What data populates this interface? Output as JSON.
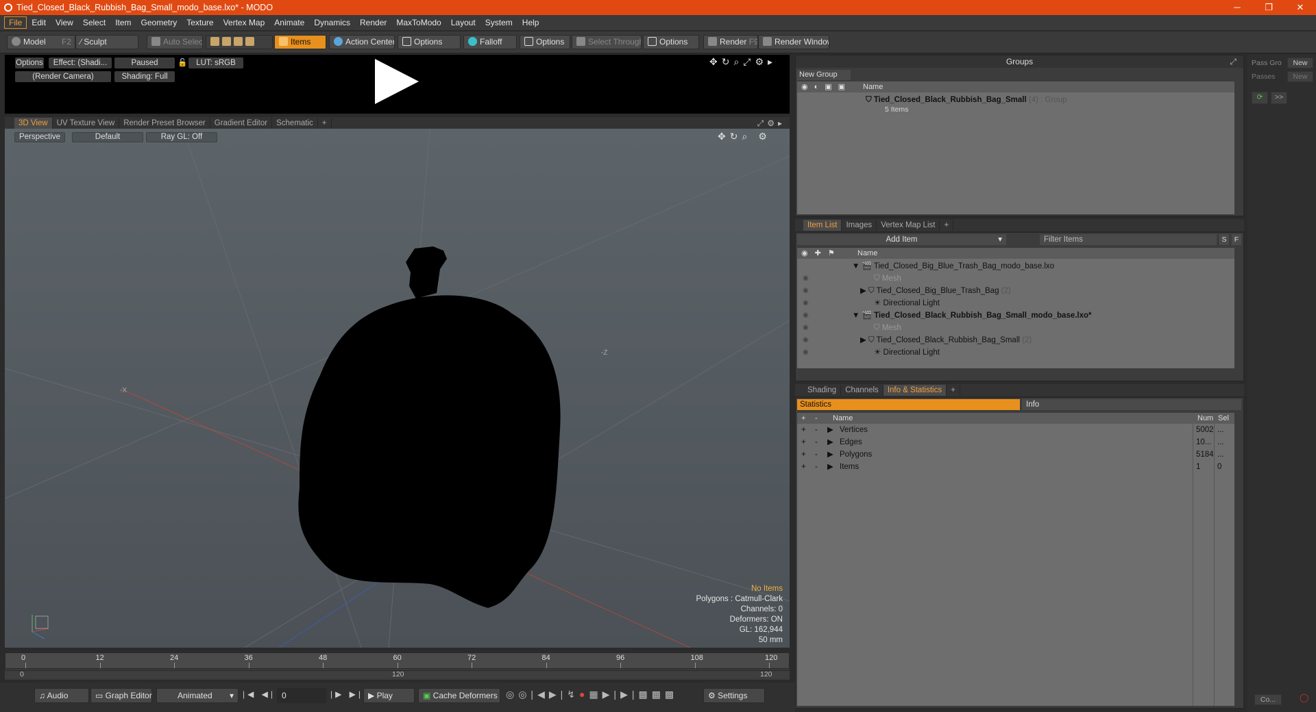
{
  "window": {
    "title": "Tied_Closed_Black_Rubbish_Bag_Small_modo_base.lxo* - MODO",
    "min": "─",
    "max": "❐",
    "close": "✕"
  },
  "menu": [
    "File",
    "Edit",
    "View",
    "Select",
    "Item",
    "Geometry",
    "Texture",
    "Vertex Map",
    "Animate",
    "Dynamics",
    "Render",
    "MaxToModo",
    "Layout",
    "System",
    "Help"
  ],
  "toolbar": {
    "model": "Model",
    "model_key": "F2",
    "sculpt": "Sculpt",
    "auto_select": "Auto Select",
    "items": "Items",
    "action_center": "Action Center",
    "options1": "Options",
    "falloff": "Falloff",
    "options2": "Options",
    "select_through": "Select Through",
    "options3": "Options",
    "render": "Render",
    "render_key": "F9",
    "render_window": "Render Window"
  },
  "preview": {
    "options": "Options",
    "effect": "Effect: (Shadi...",
    "paused": "Paused",
    "lut": "LUT: sRGB",
    "camera": "(Render Camera)",
    "shading": "Shading: Full"
  },
  "viewtabs": [
    "3D View",
    "UV Texture View",
    "Render Preset Browser",
    "Gradient Editor",
    "Schematic",
    "+"
  ],
  "viewport": {
    "perspective": "Perspective",
    "default": "Default",
    "raygl": "Ray GL: Off",
    "info": {
      "no_items": "No Items",
      "polygons": "Polygons : Catmull-Clark",
      "channels": "Channels: 0",
      "deformers": "Deformers: ON",
      "gl": "GL: 162,944",
      "mm": "50 mm"
    },
    "axis_x": "-X",
    "axis_z": "-Z"
  },
  "timeline": {
    "ticks": [
      "0",
      "12",
      "24",
      "36",
      "48",
      "60",
      "72",
      "84",
      "96",
      "108",
      "120"
    ],
    "start": "0",
    "mid": "120",
    "end": "120"
  },
  "bottom": {
    "audio": "Audio",
    "graph_editor": "Graph Editor",
    "animated": "Animated",
    "frame": "0",
    "play": "Play",
    "cache": "Cache Deformers",
    "settings": "Settings"
  },
  "groups": {
    "title": "Groups",
    "new_group": "New Group",
    "col_name": "Name",
    "group_name": "Tied_Closed_Black_Rubbish_Bag_Small",
    "group_count": "(4)",
    "group_type": ": Group",
    "group_items": "5 Items"
  },
  "pass": {
    "pass_groups": "Pass Gro",
    "passes": "Passes",
    "new1": "New",
    "new2": "New",
    "more": ">>",
    "co": "Co..."
  },
  "itemlist": {
    "tabs": [
      "Item List",
      "Images",
      "Vertex Map List",
      "+"
    ],
    "add_item": "Add Item",
    "filter": "Filter Items",
    "s": "S",
    "f": "F",
    "col_name": "Name",
    "rows": [
      {
        "label": "Tied_Closed_Big_Blue_Trash_Bag_modo_base.lxo",
        "extra": ""
      },
      {
        "label": "Mesh",
        "extra": ""
      },
      {
        "label": "Tied_Closed_Big_Blue_Trash_Bag",
        "extra": "(2)"
      },
      {
        "label": "Directional Light",
        "extra": ""
      },
      {
        "label": "Tied_Closed_Black_Rubbish_Bag_Small_modo_base.lxo*",
        "extra": ""
      },
      {
        "label": "Mesh",
        "extra": ""
      },
      {
        "label": "Tied_Closed_Black_Rubbish_Bag_Small",
        "extra": "(2)"
      },
      {
        "label": "Directional Light",
        "extra": ""
      }
    ]
  },
  "stats": {
    "tabs": [
      "Shading",
      "Channels",
      "Info & Statistics",
      "+"
    ],
    "statistics": "Statistics",
    "info": "Info",
    "col_name": "Name",
    "col_num": "Num",
    "col_sel": "Sel",
    "rows": [
      {
        "name": "Vertices",
        "num": "5002",
        "sel": "..."
      },
      {
        "name": "Edges",
        "num": "10...",
        "sel": "..."
      },
      {
        "name": "Polygons",
        "num": "5184",
        "sel": "..."
      },
      {
        "name": "Items",
        "num": "1",
        "sel": "0"
      }
    ],
    "plus": "+",
    "minus": "-"
  }
}
